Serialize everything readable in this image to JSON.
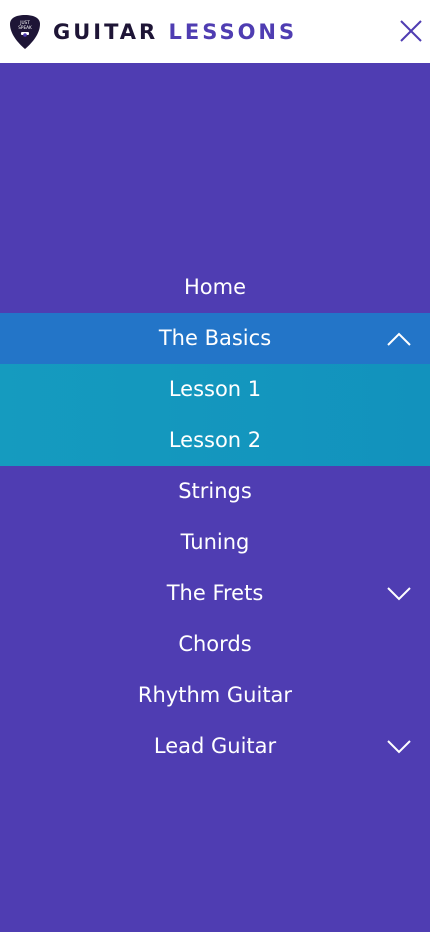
{
  "header": {
    "brand_word_1": "GUITAR",
    "brand_word_2": "LESSONS",
    "logo_text_line1": "JUST",
    "logo_text_line2": "SPEAK",
    "close_icon": "close-icon"
  },
  "colors": {
    "background": "#4f3db2",
    "header_bg": "#ffffff",
    "brand_dark": "#1e1536",
    "brand_accent": "#4f3db2",
    "active_item": "#2375c8",
    "submenu_bg": "#1497be",
    "menu_text": "#ffffff"
  },
  "menu": {
    "home": "Home",
    "the_basics": "The Basics",
    "lesson_1": "Lesson 1",
    "lesson_2": "Lesson 2",
    "strings": "Strings",
    "tuning": "Tuning",
    "the_frets": "The Frets",
    "chords": "Chords",
    "rhythm_guitar": "Rhythm Guitar",
    "lead_guitar": "Lead Guitar"
  },
  "icons": {
    "expanded": "chevron-up-icon",
    "collapsed": "chevron-down-icon"
  }
}
